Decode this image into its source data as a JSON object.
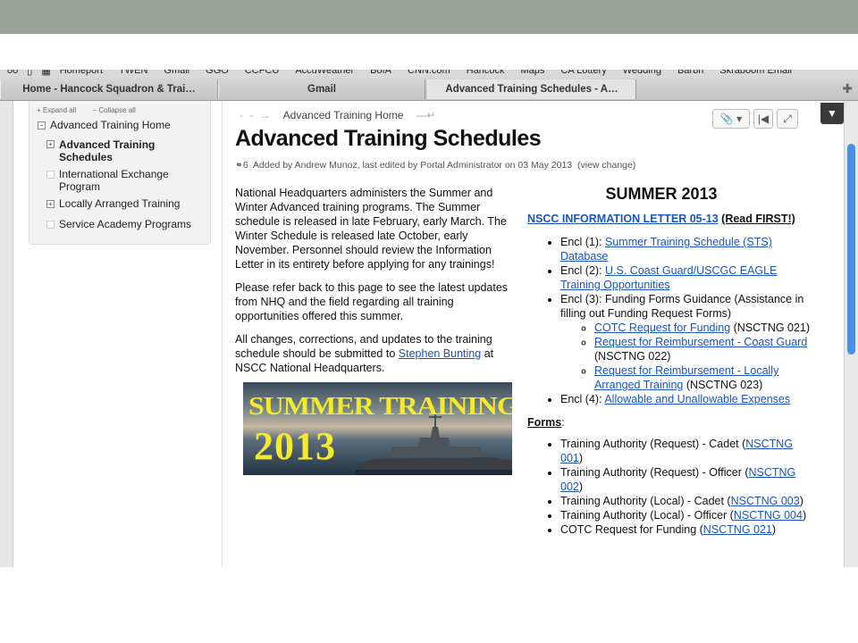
{
  "bookmarks": [
    "Homeport",
    "TWEN",
    "Gmail",
    "GGO",
    "CCFCU",
    "AccuWeather",
    "BofA",
    "CNN.com",
    "Hancock",
    "Maps",
    "CA Lottery",
    "Wedding",
    "Barbri",
    "Skraboom Email"
  ],
  "tabs": [
    {
      "label": "Home - Hancock Squadron & Trai…"
    },
    {
      "label": "Gmail"
    },
    {
      "label": "Advanced Training Schedules - A…"
    }
  ],
  "sidebar": {
    "expand_all": "Expand all",
    "collapse_all": "Collapse all",
    "home": "Advanced Training Home",
    "items": [
      {
        "label": "Advanced Training Schedules"
      },
      {
        "label": "International Exchange Program"
      },
      {
        "label": "Locally Arranged Training"
      },
      {
        "label": "Service Academy Programs"
      }
    ]
  },
  "breadcrumb": "Advanced Training Home",
  "page_title": "Advanced Training Schedules",
  "meta": {
    "count": "6",
    "text": "Added by Andrew Munoz, last edited by Portal Administrator on 03 May 2013",
    "view_change": "(view change)"
  },
  "left": {
    "p1": "National Headquarters administers the Summer and Winter Advanced training programs. The Summer schedule is released in late February, early March. The Winter Schedule is released late October, early November. Personnel should review the Information Letter in its entirety before applying for any trainings!",
    "p2": "Please refer back to this page to see the latest updates from NHQ and the field regarding all training opportunities offered this summer.",
    "p3_pre": "All changes, corrections, and updates to the training schedule should be submitted to ",
    "p3_link": "Stephen Bunting",
    "p3_post": " at NSCC National Headquarters."
  },
  "banner": {
    "line1": "SUMMER TRAINING",
    "line2": "2013"
  },
  "right": {
    "heading": "SUMMER 2013",
    "info_link": "NSCC INFORMATION LETTER 05-13",
    "info_note": "(Read FIRST!)",
    "encl1_pre": "Encl (1): ",
    "encl1_link": "Summer Training Schedule (STS) Database",
    "encl2_pre": "Encl (2): ",
    "encl2_link": "U.S. Coast Guard/USCGC EAGLE Training Opportunities",
    "encl3": "Encl (3): Funding Forms Guidance (Assistance in filling out Funding Request Forms)",
    "sub1_link": "COTC Request for Funding",
    "sub1_post": " (NSCTNG 021)",
    "sub2_link": "Request for Reimbursement - Coast Guard",
    "sub2_post": " (NSCTNG 022)",
    "sub3_link": "Request for Reimbursement - Locally Arranged Training",
    "sub3_post": " (NSCTNG 023)",
    "encl4_pre": "Encl (4): ",
    "encl4_link": "Allowable and Unallowable Expenses",
    "forms_label": "Forms",
    "forms_colon": ":",
    "f1_pre": "Training Authority (Request) - Cadet (",
    "f1_link": "NSCTNG 001",
    "f2_pre": "Training Authority (Request) - Officer (",
    "f2_link": "NSCTNG 002",
    "f3_pre": "Training Authority (Local) - Cadet (",
    "f3_link": "NSCTNG 003",
    "f4_pre": "Training Authority (Local) - Officer (",
    "f4_link": "NSCTNG 004",
    "f5_pre": "COTC Request for Funding (",
    "f5_link": "NSCTNG 021",
    "close_paren": ")"
  }
}
